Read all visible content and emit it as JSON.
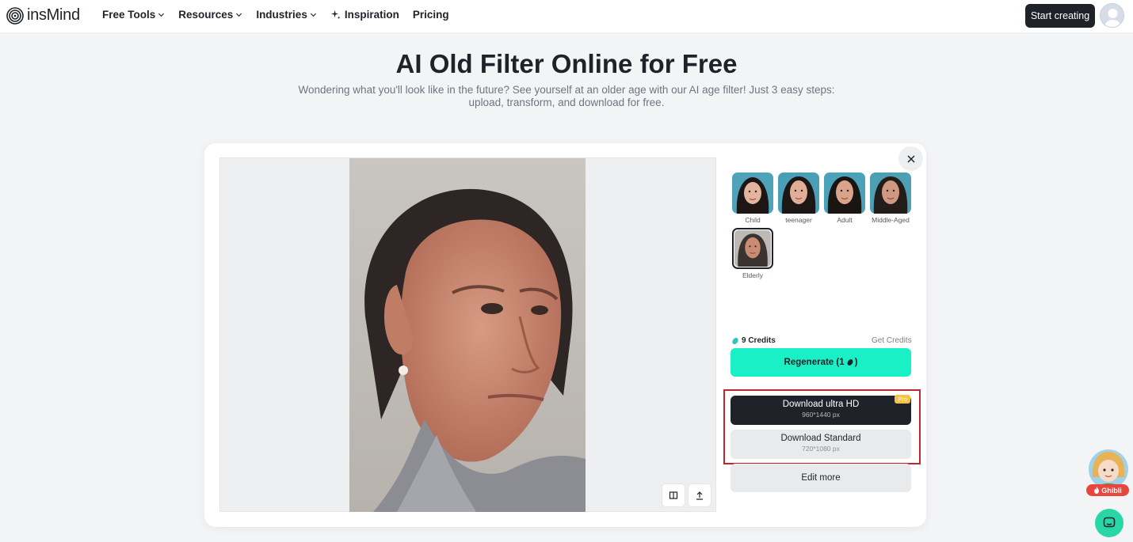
{
  "header": {
    "brand": "insMind",
    "nav": [
      {
        "label": "Free Tools",
        "dropdown": true
      },
      {
        "label": "Resources",
        "dropdown": true
      },
      {
        "label": "Industries",
        "dropdown": true
      },
      {
        "label": "Inspiration",
        "icon": "sparkle-icon"
      },
      {
        "label": "Pricing"
      }
    ],
    "start_label": "Start creating"
  },
  "hero": {
    "title": "AI Old Filter Online for Free",
    "subtitle": "Wondering what you'll look like in the future? See yourself at an older age with our AI age filter! Just 3 easy steps: upload, transform, and download for free."
  },
  "panel": {
    "styles": [
      {
        "label": "Child",
        "selected": false
      },
      {
        "label": "teenager",
        "selected": false
      },
      {
        "label": "Adult",
        "selected": false
      },
      {
        "label": "Middle-Aged",
        "selected": false
      },
      {
        "label": "Elderly",
        "selected": true
      }
    ],
    "credits_label": "9 Credits",
    "get_credits_label": "Get Credits",
    "regenerate_label": "Regenerate (1",
    "regenerate_suffix": ")",
    "download_hd": {
      "label": "Download ultra HD",
      "size": "960*1440 px",
      "badge": "Pro"
    },
    "download_standard": {
      "label": "Download Standard",
      "size": "720*1080 px"
    },
    "edit_more_label": "Edit more"
  },
  "floating": {
    "ghibli_label": "Ghibli"
  },
  "colors": {
    "accent": "#19f0c6",
    "dark": "#1f2329",
    "highlight_border": "#c0262d",
    "chat": "#29d6a6"
  }
}
